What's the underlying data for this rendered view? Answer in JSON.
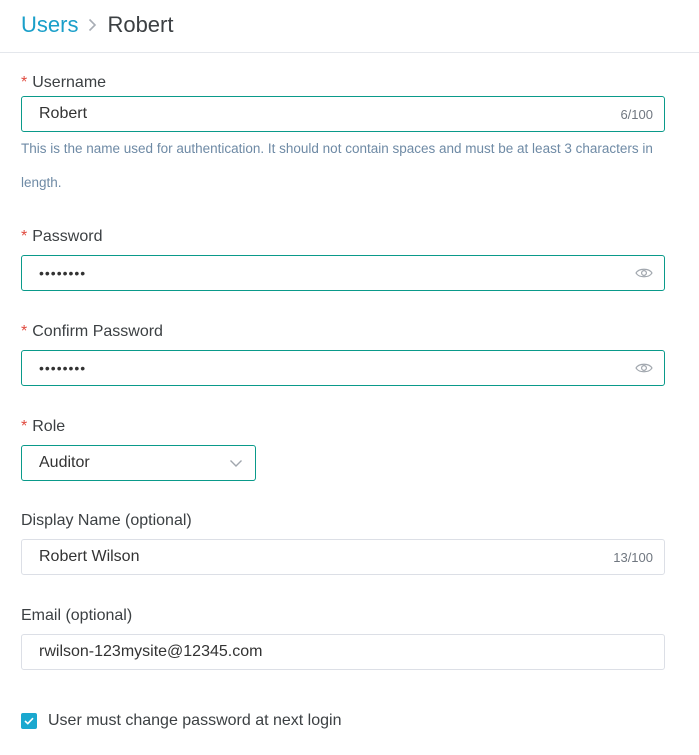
{
  "breadcrumb": {
    "parent": "Users",
    "current": "Robert"
  },
  "form": {
    "required_mark": "*",
    "username": {
      "label": "Username",
      "value": "Robert",
      "count": "6/100",
      "help": "This is the name used for authentication. It should not contain spaces and must be at least 3 characters in length."
    },
    "password": {
      "label": "Password",
      "masked_value": "••••••••",
      "toggle_icon": "eye-icon"
    },
    "confirm_password": {
      "label": "Confirm Password",
      "masked_value": "••••••••",
      "toggle_icon": "eye-icon"
    },
    "role": {
      "label": "Role",
      "selected": "Auditor"
    },
    "display_name": {
      "label": "Display Name (optional)",
      "value": "Robert Wilson",
      "count": "13/100"
    },
    "email": {
      "label": "Email (optional)",
      "value": "rwilson-123mysite@12345.com"
    },
    "must_change_password": {
      "label": "User must change password at next login",
      "checked": true
    }
  },
  "colors": {
    "accent": "#1a9fc9",
    "focus_border": "#0a9a8a",
    "required": "#e04a3f",
    "help_text": "#6e8aa5"
  }
}
